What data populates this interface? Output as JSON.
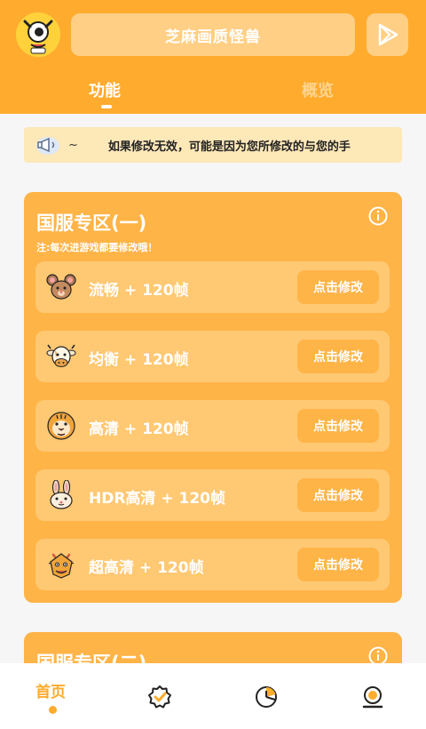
{
  "header": {
    "title": "芝麻画质怪兽",
    "avatar_icon": "monster-face-icon",
    "play_icon": "play-store-icon"
  },
  "tabs": [
    {
      "label": "功能",
      "active": true
    },
    {
      "label": "概览",
      "active": false
    }
  ],
  "notice": {
    "tilde": "~",
    "text": "如果修改无效，可能是因为您所修改的与您的手"
  },
  "section1": {
    "title": "国服专区(一)",
    "note": "注:每次进游戏都要修改哦！",
    "rows": [
      {
        "label": "流畅 + 120帧",
        "button": "点击修改",
        "icon": "mouse-face-icon"
      },
      {
        "label": "均衡 + 120帧",
        "button": "点击修改",
        "icon": "cow-face-icon"
      },
      {
        "label": "高清 + 120帧",
        "button": "点击修改",
        "icon": "tiger-face-icon"
      },
      {
        "label": "HDR高清 + 120帧",
        "button": "点击修改",
        "icon": "rabbit-face-icon"
      },
      {
        "label": "超高清 + 120帧",
        "button": "点击修改",
        "icon": "dragon-face-icon"
      }
    ]
  },
  "section2": {
    "title": "国服专区(二)"
  },
  "nav": {
    "home": "首页",
    "items": [
      "home",
      "badge-check-icon",
      "pie-chart-icon",
      "profile-icon"
    ]
  },
  "colors": {
    "brand": "#ffab2e",
    "card": "#ffb447",
    "row": "#ffc873",
    "notice_bg": "#fde8b8"
  }
}
